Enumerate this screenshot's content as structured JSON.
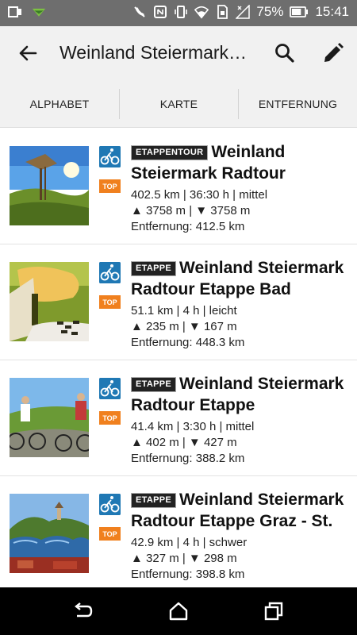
{
  "status_bar": {
    "battery_percent": "75%",
    "time": "15:41",
    "battery_level": 0.75
  },
  "app_bar": {
    "title": "Weinland Steiermark…",
    "icons": [
      "back-arrow-icon",
      "search-icon",
      "edit-pencil-icon"
    ]
  },
  "tabs": [
    {
      "label": "ALPHABET",
      "selected": true
    },
    {
      "label": "KARTE",
      "selected": false
    },
    {
      "label": "ENTFERNUNG",
      "selected": false
    }
  ],
  "colors": {
    "accent": "#1f78b4",
    "top_badge": "#f0801e",
    "status_bar": "#6e6e6e",
    "app_bar": "#f1f1f1"
  },
  "items": [
    {
      "badge": "ETAPPENTOUR",
      "title": "Weinland Steiermark Radtour",
      "stats": "402.5 km | 36:30 h | mittel",
      "elevation": "▲ 3758 m | ▼ 3758 m",
      "distance": "Entfernung: 412.5 km",
      "tag": "TOP",
      "icon": "bike-icon"
    },
    {
      "badge": "ETAPPE",
      "title": "Weinland Steiermark Radtour Etappe Bad",
      "stats": "51.1 km | 4 h | leicht",
      "elevation": "▲ 235 m | ▼ 167 m",
      "distance": "Entfernung: 448.3 km",
      "tag": "TOP",
      "icon": "bike-icon"
    },
    {
      "badge": "ETAPPE",
      "title": "Weinland Steiermark Radtour Etappe",
      "stats": "41.4 km | 3:30 h | mittel",
      "elevation": "▲ 402 m | ▼ 427 m",
      "distance": "Entfernung: 388.2 km",
      "tag": "TOP",
      "icon": "bike-icon"
    },
    {
      "badge": "ETAPPE",
      "title": "Weinland Steiermark Radtour Etappe Graz - St.",
      "stats": "42.9 km | 4 h | schwer",
      "elevation": "▲ 327 m | ▼ 298 m",
      "distance": "Entfernung: 398.8 km",
      "tag": "TOP",
      "icon": "bike-icon"
    }
  ]
}
